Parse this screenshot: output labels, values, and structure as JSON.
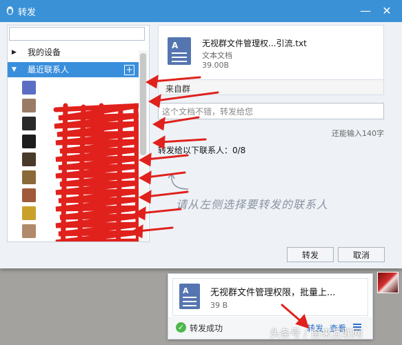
{
  "window": {
    "title": "转发",
    "minimize": "—",
    "close": "✕"
  },
  "colors": {
    "titlebar": "#3a91d6",
    "selected_group": "#3a8fdc",
    "file_icon": "#5575b0",
    "annotation_red": "#e0211c",
    "success": "#4cb84c",
    "link": "#2a6fc9"
  },
  "search": {
    "placeholder": ""
  },
  "groups": [
    {
      "label": "我的设备",
      "expanded": false,
      "selected": false
    },
    {
      "label": "最近联系人",
      "expanded": true,
      "selected": true,
      "add_icon": "+"
    }
  ],
  "contacts": [
    {
      "name": "",
      "avatar_color": "#5c6ec4"
    },
    {
      "name": "",
      "avatar_color": "#9a7c66"
    },
    {
      "name": "",
      "avatar_color": "#2a2a2a"
    },
    {
      "name": "",
      "avatar_color": "#1d1d1d"
    },
    {
      "name": "",
      "avatar_color": "#4a3a2a"
    },
    {
      "name": "",
      "avatar_color": "#8a6a3a"
    },
    {
      "name": "",
      "avatar_color": "#a05a3a"
    },
    {
      "name": "",
      "avatar_color": "#c9a12a"
    },
    {
      "name": "",
      "avatar_color": "#b08a6a"
    }
  ],
  "file": {
    "name": "无视群文件管理权...引流.txt",
    "type": "文本文档",
    "size": "39.00B",
    "source": "来自群"
  },
  "message": {
    "placeholder": "这个文档不错，转发给您"
  },
  "counter": "还能输入140字",
  "forward_count": "转发给以下联系人：0/8",
  "hint": "请从左侧选择要转发的联系人",
  "buttons": {
    "forward": "转发",
    "cancel": "取消"
  },
  "notification": {
    "file_name": "无视群文件管理权限，批量上...",
    "file_size": "39 B",
    "status": "转发成功",
    "action_forward": "转发",
    "action_view": "查看"
  },
  "icons": {
    "title": "qq-penguin-icon",
    "file": "text-document-icon",
    "success": "check-circle-icon",
    "menu": "menu-lines-icon"
  },
  "watermark": "头条号 / 自来互联网"
}
